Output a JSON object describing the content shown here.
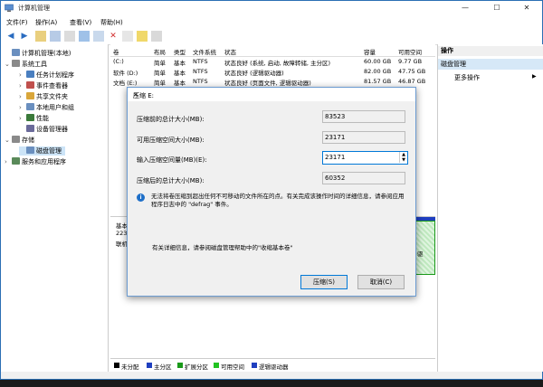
{
  "window": {
    "title": "计算机管理",
    "min": "—",
    "max": "☐",
    "close": "✕"
  },
  "menu": [
    "文件(F)",
    "操作(A)",
    "查看(V)",
    "帮助(H)"
  ],
  "tree": [
    {
      "label": "计算机管理(本地)",
      "chev": "",
      "color": "#6a8fbf"
    },
    {
      "label": "系统工具",
      "chev": "⌄",
      "color": "#8a8a8a"
    },
    {
      "label": "任务计划程序",
      "chev": "›",
      "color": "#4a7fc0"
    },
    {
      "label": "事件查看器",
      "chev": "›",
      "color": "#c0504d"
    },
    {
      "label": "共享文件夹",
      "chev": "›",
      "color": "#d9a63a"
    },
    {
      "label": "本地用户和组",
      "chev": "›",
      "color": "#6a8fbf"
    },
    {
      "label": "性能",
      "chev": "›",
      "color": "#3a7a3a"
    },
    {
      "label": "设备管理器",
      "chev": "",
      "color": "#6a6a9a"
    },
    {
      "label": "存储",
      "chev": "⌄",
      "color": "#8a8a8a"
    },
    {
      "label": "磁盘管理",
      "chev": "",
      "color": "#6a8fbf"
    },
    {
      "label": "服务和应用程序",
      "chev": "›",
      "color": "#5a8a5a"
    }
  ],
  "volume_headers": [
    "卷",
    "布局",
    "类型",
    "文件系统",
    "状态",
    "容量",
    "可用空间"
  ],
  "volumes": [
    [
      "(C:)",
      "简单",
      "基本",
      "NTFS",
      "状态良好 (系统, 启动, 故障转储, 主分区)",
      "60.00 GB",
      "9.77 GB"
    ],
    [
      "软件 (D:)",
      "简单",
      "基本",
      "NTFS",
      "状态良好 (逻辑驱动器)",
      "82.00 GB",
      "47.75 GB"
    ],
    [
      "文档 (E:)",
      "简单",
      "基本",
      "NTFS",
      "状态良好 (页面文件, 逻辑驱动器)",
      "81.57 GB",
      "46.87 GB"
    ]
  ],
  "graph": {
    "label1": "基本",
    "label2": "223.",
    "label3": "联机",
    "side": "驱"
  },
  "legend": [
    {
      "label": "未分配",
      "color": "#000000"
    },
    {
      "label": "主分区",
      "color": "#1f3fbf"
    },
    {
      "label": "扩展分区",
      "color": "#1a9a1a"
    },
    {
      "label": "可用空间",
      "color": "#22c322"
    },
    {
      "label": "逻辑驱动器",
      "color": "#1f3fbf"
    }
  ],
  "actions": {
    "header": "操作",
    "selected": "磁盘管理",
    "more": "更多操作"
  },
  "dialog": {
    "title": "压缩 E:",
    "close": "✕",
    "rows": [
      {
        "label": "压缩前的总计大小(MB):",
        "value": "83523"
      },
      {
        "label": "可用压缩空间大小(MB):",
        "value": "23171"
      },
      {
        "label": "输入压缩空间量(MB)(E):",
        "value": "23171"
      },
      {
        "label": "压缩后的总计大小(MB):",
        "value": "60352"
      }
    ],
    "info": "无法将卷压缩到超出任何不可移动的文件所在的点。有关完成该操作时间的详细信息，请参阅应用程序日志中的 \"defrag\" 事件。",
    "more": "有关详细信息，请参阅磁盘管理帮助中的\"收缩基本卷\"",
    "ok": "压缩(S)",
    "cancel": "取消(C)"
  }
}
